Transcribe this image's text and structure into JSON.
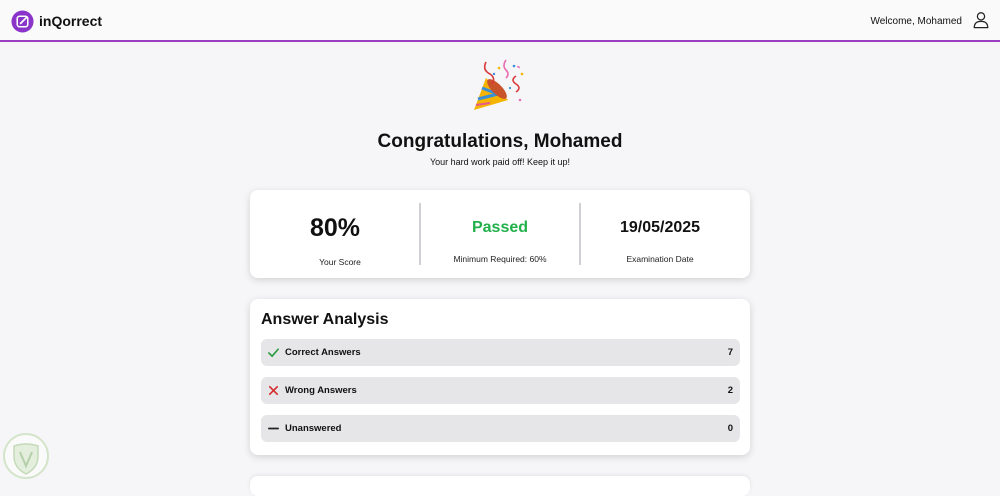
{
  "header": {
    "app_name": "inQorrect",
    "welcome_text": "Welcome, Mohamed",
    "logo_icon": "pen-badge-icon",
    "user_icon": "user-icon",
    "accent_color": "#9b3fc0"
  },
  "hero": {
    "icon": "party-popper-icon",
    "title": "Congratulations, Mohamed",
    "subtitle": "Your hard work paid off! Keep it up!"
  },
  "stats": {
    "score_value": "80%",
    "score_label": "Your Score",
    "status_value": "Passed",
    "status_label": "Minimum Required: 60%",
    "status_color": "#22b04a",
    "date_value": "19/05/2025",
    "date_label": "Examination Date"
  },
  "analysis": {
    "title": "Answer Analysis",
    "rows": [
      {
        "icon": "check-icon",
        "label": "Correct Answers",
        "count": "7",
        "color": "#2a9b3e"
      },
      {
        "icon": "cross-icon",
        "label": "Wrong Answers",
        "count": "2",
        "color": "#d32f2f"
      },
      {
        "icon": "dash-icon",
        "label": "Unanswered",
        "count": "0",
        "color": "#222222"
      }
    ]
  }
}
